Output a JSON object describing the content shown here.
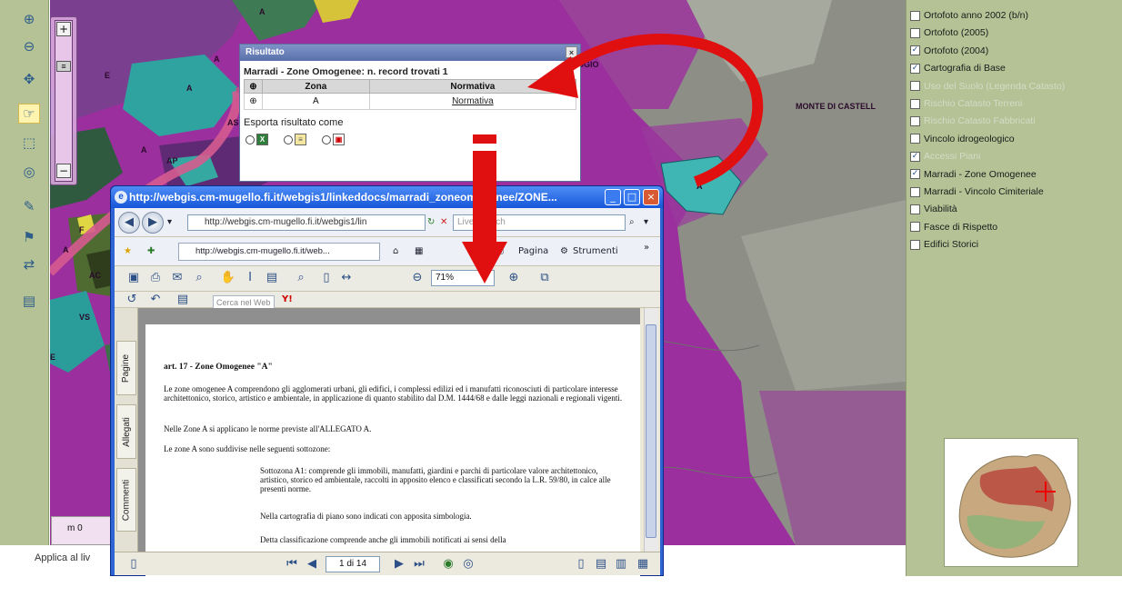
{
  "left_toolbar": {
    "apply_label": "Applica al liv"
  },
  "zoom_slider": {
    "plus": "+",
    "minus": "−"
  },
  "map": {
    "labels": {
      "a1": "A",
      "a2": "A",
      "a3": "A",
      "a4": "A",
      "a5": "A",
      "a6": "A",
      "a7": "A",
      "as": "AS",
      "ap": "AP",
      "ac": "AC",
      "vs": "VS",
      "e1": "E",
      "e2": "E",
      "f": "F",
      "poggio": "GGIO",
      "monte": "MONTE DI CASTELL"
    },
    "scale_text": "m  0"
  },
  "result_popup": {
    "title": "Risultato",
    "close": "×",
    "heading": "Marradi - Zone Omogenee: n. record trovati 1",
    "columns": [
      "⊕",
      "Zona",
      "Normativa"
    ],
    "row": {
      "zona": "A",
      "normativa": "Normativa"
    },
    "export_label": "Esporta risultato come"
  },
  "layers": [
    {
      "label": "Ortofoto anno 2002 (b/n)",
      "checked": false,
      "dim": false
    },
    {
      "label": "Ortofoto (2005)",
      "checked": false,
      "dim": false
    },
    {
      "label": "Ortofoto (2004)",
      "checked": true,
      "dim": false
    },
    {
      "label": "Cartografia di Base",
      "checked": true,
      "dim": false
    },
    {
      "label": "Uso del Suolo (Legenda Catasto)",
      "checked": false,
      "dim": true
    },
    {
      "label": "Rischio Catasto Terreni",
      "checked": false,
      "dim": true
    },
    {
      "label": "Rischio Catasto Fabbricati",
      "checked": false,
      "dim": true
    },
    {
      "label": "Vincolo idrogeologico",
      "checked": false,
      "dim": false
    },
    {
      "label": "Accessi Piani",
      "checked": true,
      "dim": true
    },
    {
      "label": "Marradi - Zone Omogenee",
      "checked": true,
      "dim": false
    },
    {
      "label": "Marradi - Vincolo Cimiteriale",
      "checked": false,
      "dim": false
    },
    {
      "label": "Viabilità",
      "checked": false,
      "dim": false
    },
    {
      "label": "Fasce di Rispetto",
      "checked": false,
      "dim": false
    },
    {
      "label": "Edifici Storici",
      "checked": false,
      "dim": false
    }
  ],
  "browser": {
    "title": "http://webgis.cm-mugello.fi.it/webgis1/linkeddocs/marradi_zoneomogenee/ZONE...",
    "address": "http://webgis.cm-mugello.fi.it/webgis1/lin",
    "search_placeholder": "Live Search",
    "tab_label": "http://webgis.cm-mugello.fi.it/web...",
    "page_menu": "Pagina",
    "tools_menu": "Strumenti",
    "zoom_value": "71%",
    "web_search": "Cerca nel Web",
    "yahoo": "Y!",
    "side_tabs": [
      "Pagine",
      "Allegati",
      "Commenti"
    ],
    "page_indicator": "1 di 14",
    "pdf": {
      "heading": "art. 17 - Zone Omogenee \"A\"",
      "p1": "Le zone omogenee A comprendono gli agglomerati urbani, gli edifici, i complessi edilizi ed i manufatti riconosciuti di particolare interesse architettonico, storico, artistico e ambientale, in applicazione di quanto stabilito dal D.M. 1444/68 e dalle leggi nazionali e regionali vigenti.",
      "p2": "Nelle Zone A si applicano le norme previste all'ALLEGATO A.",
      "p3": "Le zone A sono suddivise nelle seguenti sottozone:",
      "p4": "Sottozona A1: comprende gli immobili, manufatti, giardini e parchi di particolare valore architettonico, artistico, storico ed ambientale, raccolti in apposito elenco e classificati secondo la L.R. 59/80, in calce alle presenti norme.",
      "p5": "Nella cartografia di piano sono indicati con apposita simbologia.",
      "p6": "Detta classificazione comprende anche gli immobili notificati ai sensi della"
    }
  }
}
